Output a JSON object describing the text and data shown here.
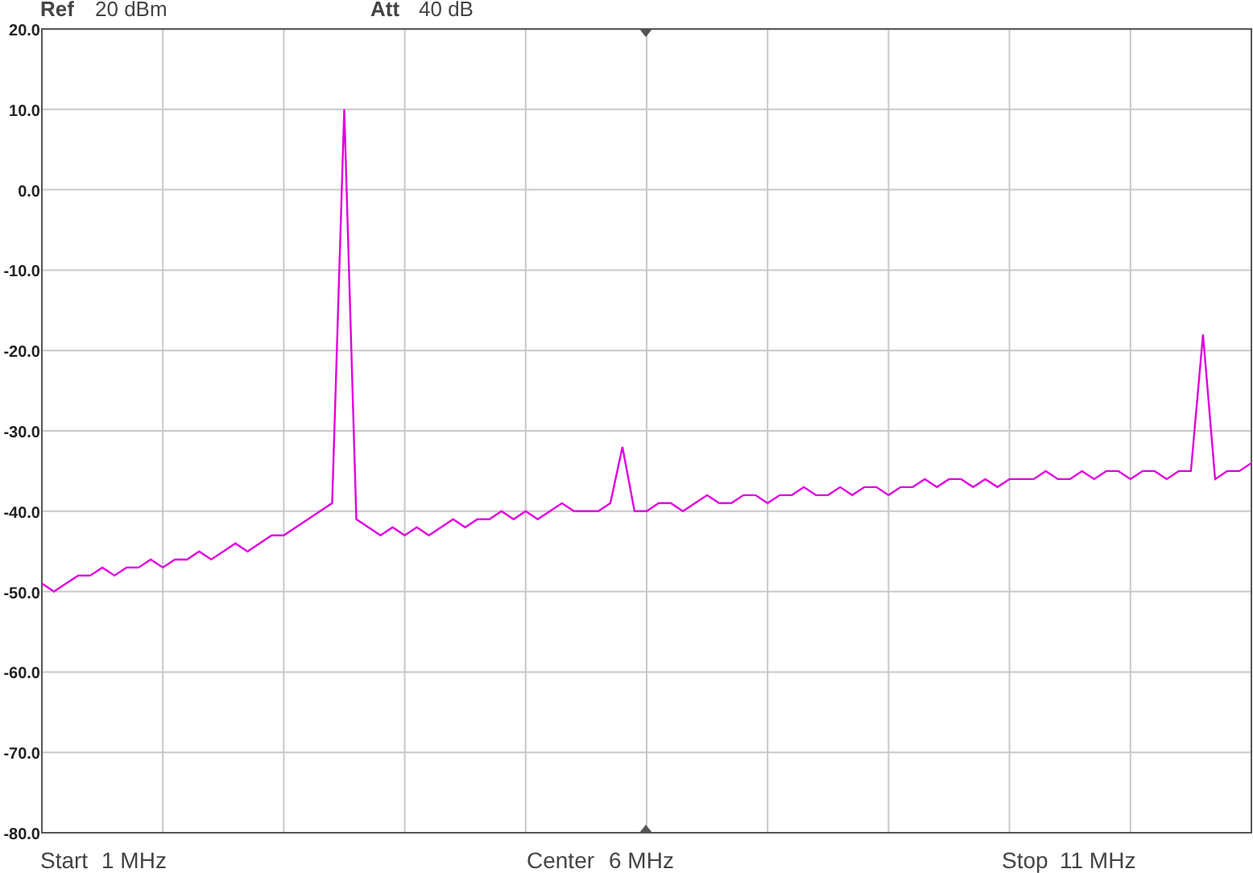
{
  "header": [
    {
      "label": "Ref",
      "value": "20 dBm"
    },
    {
      "label": "Att",
      "value": "40 dB"
    }
  ],
  "chart": {
    "chart_data": {
      "type": "line",
      "grid": true,
      "ylim": [
        -80,
        20
      ],
      "yticks": [
        {
          "value": 20,
          "label": "20.0"
        },
        {
          "value": 10,
          "label": "10.0"
        },
        {
          "value": 0,
          "label": "0.0"
        },
        {
          "value": -10,
          "label": "-10.0"
        },
        {
          "value": -20,
          "label": "-20.0"
        },
        {
          "value": -30,
          "label": "-30.0"
        },
        {
          "value": -40,
          "label": "-40.0"
        },
        {
          "value": -50,
          "label": "-50.0"
        },
        {
          "value": -60,
          "label": "-60.0"
        },
        {
          "value": -70,
          "label": "-70.0"
        },
        {
          "value": -80,
          "label": "-80.0"
        }
      ],
      "categories": [
        null,
        null,
        null,
        null,
        null,
        null,
        null,
        null,
        null,
        null,
        null,
        null,
        null,
        null,
        null,
        null,
        null,
        null,
        null,
        null,
        null,
        null,
        null,
        null,
        null,
        null,
        null,
        null,
        null,
        null,
        null,
        null,
        null,
        null,
        null,
        null,
        null,
        null,
        null,
        null,
        null,
        null,
        null,
        null,
        null,
        null,
        null,
        null,
        null,
        null,
        null,
        null,
        null,
        null,
        null,
        null,
        null,
        null,
        null,
        null,
        null,
        null,
        null,
        null,
        null,
        null,
        null,
        null,
        null,
        null,
        null,
        null,
        null,
        null,
        null,
        null,
        null,
        null,
        null,
        null,
        null,
        null,
        null,
        null,
        null,
        null,
        null,
        null,
        null,
        null,
        null,
        null,
        null,
        null,
        null,
        null,
        null,
        null,
        null,
        null,
        null
      ],
      "series": [
        {
          "color": "#e000e0",
          "values": [
            -49,
            -50,
            -49,
            -48,
            -48,
            -47,
            -48,
            -47,
            -47,
            -46,
            -47,
            -46,
            -46,
            -45,
            -46,
            -45,
            -44,
            -45,
            -44,
            -43,
            -43,
            -42,
            -41,
            -40,
            -39,
            10,
            -41,
            -42,
            -43,
            -42,
            -43,
            -42,
            -43,
            -42,
            -41,
            -42,
            -41,
            -41,
            -40,
            -41,
            -40,
            -41,
            -40,
            -39,
            -40,
            -40,
            -40,
            -39,
            -32,
            -40,
            -40,
            -39,
            -39,
            -40,
            -39,
            -38,
            -39,
            -39,
            -38,
            -38,
            -39,
            -38,
            -38,
            -37,
            -38,
            -38,
            -37,
            -38,
            -37,
            -37,
            -38,
            -37,
            -37,
            -36,
            -37,
            -36,
            -36,
            -37,
            -36,
            -37,
            -36,
            -36,
            -36,
            -35,
            -36,
            -36,
            -35,
            -36,
            -35,
            -35,
            -36,
            -35,
            -35,
            -36,
            -35,
            -35,
            -18,
            -36,
            -35,
            -35,
            -34
          ]
        }
      ]
    }
  },
  "footer": [
    {
      "label": "Start",
      "value": "1 MHz"
    },
    {
      "label": "Center",
      "value": "6 MHz"
    },
    {
      "label": "Stop",
      "value": "11 MHz"
    }
  ]
}
